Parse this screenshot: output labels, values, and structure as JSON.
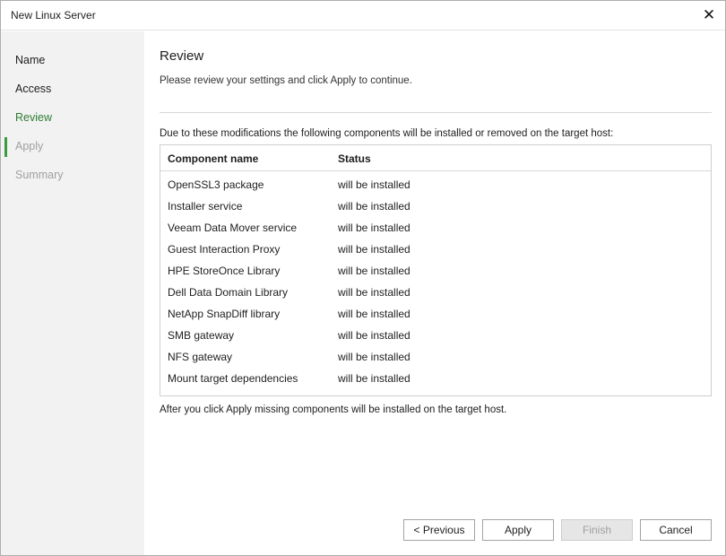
{
  "window": {
    "title": "New Linux Server",
    "close_icon": "close-icon"
  },
  "sidebar": {
    "items": [
      {
        "label": "Name",
        "state": "normal"
      },
      {
        "label": "Access",
        "state": "normal"
      },
      {
        "label": "Review",
        "state": "active"
      },
      {
        "label": "Apply",
        "state": "disabled"
      },
      {
        "label": "Summary",
        "state": "disabled"
      }
    ]
  },
  "main": {
    "heading": "Review",
    "description": "Please review your settings and click Apply to continue.",
    "intro": "Due to these modifications the following components will be installed or removed on the target host:",
    "table": {
      "columns": [
        "Component name",
        "Status"
      ],
      "rows": [
        [
          "OpenSSL3 package",
          "will be installed"
        ],
        [
          "Installer service",
          "will be installed"
        ],
        [
          "Veeam Data Mover service",
          "will be installed"
        ],
        [
          "Guest Interaction Proxy",
          "will be installed"
        ],
        [
          "HPE StoreOnce Library",
          "will be installed"
        ],
        [
          "Dell Data Domain Library",
          "will be installed"
        ],
        [
          "NetApp SnapDiff library",
          "will be installed"
        ],
        [
          "SMB gateway",
          "will be installed"
        ],
        [
          "NFS gateway",
          "will be installed"
        ],
        [
          "Mount target dependencies",
          "will be installed"
        ]
      ]
    },
    "outro": "After you click Apply missing components will be installed on the target host."
  },
  "buttons": {
    "previous": "< Previous",
    "apply": "Apply",
    "finish": "Finish",
    "cancel": "Cancel"
  },
  "colors": {
    "active_step": "#2e7d32",
    "active_marker": "#3a9b3f",
    "disabled_text": "#a0a0a0",
    "sidebar_bg": "#f2f2f2"
  }
}
